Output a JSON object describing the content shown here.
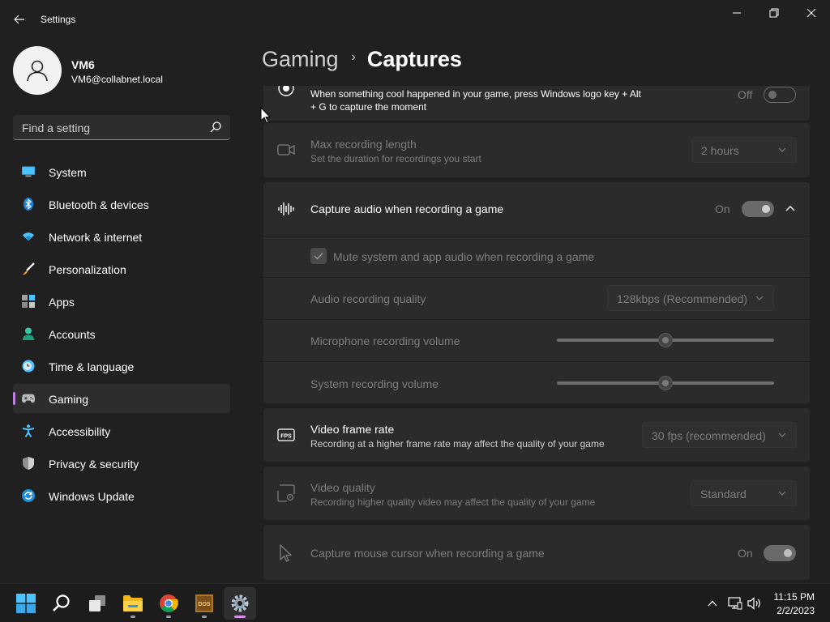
{
  "window": {
    "title": "Settings"
  },
  "profile": {
    "name": "VM6",
    "email": "VM6@collabnet.local"
  },
  "search": {
    "placeholder": "Find a setting"
  },
  "nav": {
    "items": [
      {
        "label": "System",
        "icon": "system-icon"
      },
      {
        "label": "Bluetooth & devices",
        "icon": "bluetooth-icon"
      },
      {
        "label": "Network & internet",
        "icon": "network-icon"
      },
      {
        "label": "Personalization",
        "icon": "brush-icon"
      },
      {
        "label": "Apps",
        "icon": "apps-icon"
      },
      {
        "label": "Accounts",
        "icon": "accounts-icon"
      },
      {
        "label": "Time & language",
        "icon": "clock-icon"
      },
      {
        "label": "Gaming",
        "icon": "controller-icon",
        "selected": true
      },
      {
        "label": "Accessibility",
        "icon": "accessibility-icon"
      },
      {
        "label": "Privacy & security",
        "icon": "shield-icon"
      },
      {
        "label": "Windows Update",
        "icon": "update-icon"
      }
    ],
    "accent": "#c07ee0"
  },
  "breadcrumb": {
    "parent": "Gaming",
    "separator": "›",
    "current": "Captures"
  },
  "settings": {
    "record_what_happened": {
      "desc_line1": "When something cool happened in your game, press Windows logo key + Alt",
      "desc_line2": "+ G to capture the moment",
      "toggle_label": "Off"
    },
    "max_recording": {
      "title": "Max recording length",
      "desc": "Set the duration for recordings you start",
      "value": "2 hours"
    },
    "capture_audio": {
      "title": "Capture audio when recording a game",
      "toggle_label": "On",
      "mute_label": "Mute system and app audio when recording a game",
      "quality_title": "Audio recording quality",
      "quality_value": "128kbps (Recommended)",
      "mic_title": "Microphone recording volume",
      "mic_level": 0.5,
      "system_title": "System recording volume",
      "system_level": 0.5
    },
    "frame_rate": {
      "title": "Video frame rate",
      "desc": "Recording at a higher frame rate may affect the quality of your game",
      "value": "30 fps (recommended)"
    },
    "video_quality": {
      "title": "Video quality",
      "desc": "Recording higher quality video may affect the quality of your game",
      "value": "Standard"
    },
    "mouse_cursor": {
      "title": "Capture mouse cursor when recording a game",
      "toggle_label": "On"
    }
  },
  "taskbar": {
    "time": "11:15 PM",
    "date": "2/2/2023"
  }
}
